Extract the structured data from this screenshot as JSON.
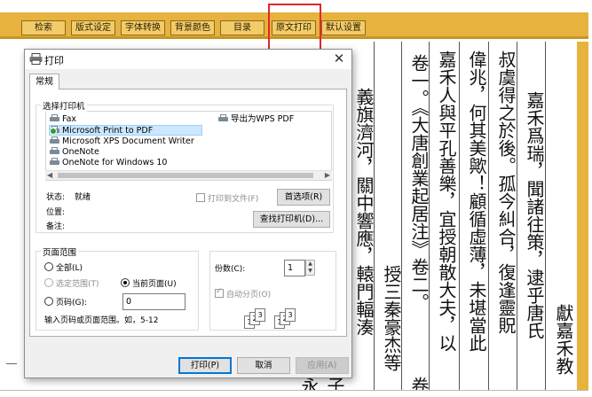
{
  "toolbar": {
    "buttons": [
      "检索",
      "版式设定",
      "字体转换",
      "背景颜色",
      "目录",
      "原文打印",
      "默认设置"
    ],
    "highlighted": "原文打印"
  },
  "document": {
    "columns": [
      "嘉禾爲瑞，聞諸往策，逮乎唐氏",
      "叔虞得之於後。孤今糾合，復逢靈貺",
      "偉兆，何其美歟！顧循虛薄，未堪當此",
      "嘉禾人與平孔善樂，宜授朝散大夫，以",
      "卷一。《大唐創業起居注》卷二。",
      "授三秦豪杰等",
      "義旗濟河，關中響應，轅門輻湊",
      "獻嘉禾教"
    ],
    "bottom_fragments": [
      "卷",
      "永",
      "子"
    ]
  },
  "dialog": {
    "title": "打印",
    "tab": "常规",
    "printer_group_label": "选择打印机",
    "printers": [
      {
        "name": "Fax",
        "selected": false
      },
      {
        "name": "Microsoft Print to PDF",
        "selected": true,
        "default": true
      },
      {
        "name": "Microsoft XPS Document Writer",
        "selected": false
      },
      {
        "name": "OneNote",
        "selected": false
      },
      {
        "name": "OneNote for Windows 10",
        "selected": false
      },
      {
        "name": "导出为WPS PDF",
        "selected": false
      }
    ],
    "status_label": "状态:",
    "status_value": "就绪",
    "location_label": "位置:",
    "comment_label": "备注:",
    "print_to_file_label": "打印到文件(F)",
    "preferences_button": "首选项(R)",
    "find_printer_button": "查找打印机(D)...",
    "page_range": {
      "label": "页面范围",
      "all": "全部(L)",
      "selection": "选定范围(T)",
      "current_page": "当前页面(U)",
      "pages": "页码(G):",
      "pages_value": "0",
      "hint": "输入页码或页面范围。如，5-12",
      "selected": "current_page"
    },
    "copies": {
      "label": "份数(C):",
      "value": "1",
      "collate_label": "自动分页(O)",
      "collate_checked": true
    },
    "print_button": "打印(P)",
    "cancel_button": "取消",
    "apply_button": "应用(A)"
  }
}
